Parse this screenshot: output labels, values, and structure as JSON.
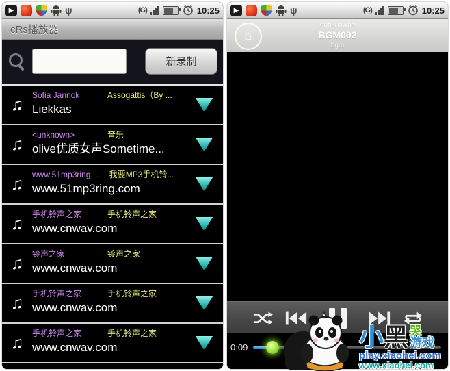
{
  "status_bar": {
    "time": "10:25",
    "data_mode": "(G)"
  },
  "left_screen": {
    "app_title": "cRs播放器",
    "search": {
      "value": "",
      "record_button": "新录制"
    },
    "songs": [
      {
        "artist": "Sofia Jannok",
        "album": "Assogattis（By ...",
        "title": "Liekkas"
      },
      {
        "artist": "<unknown>",
        "album": "音乐",
        "title": "olive优质女声Sometime..."
      },
      {
        "artist": "www.51mp3ring....",
        "album": "我要MP3手机铃...",
        "title": "www.51mp3ring.com"
      },
      {
        "artist": "手机铃声之家",
        "album": "手机铃声之家",
        "title": "www.cnwav.com"
      },
      {
        "artist": "铃声之家",
        "album": "铃声之家",
        "title": "www.cnwav.com"
      },
      {
        "artist": "手机铃声之家",
        "album": "手机铃声之家",
        "title": "www.cnwav.com"
      },
      {
        "artist": "手机铃声之家",
        "album": "手机铃声之家",
        "title": "www.cnwav.com"
      }
    ]
  },
  "right_screen": {
    "now_playing": {
      "artist": "<unknown>",
      "title": "BGM002",
      "album": "bgm"
    },
    "progress": {
      "elapsed": "0:09",
      "percent": 10
    }
  },
  "watermark": {
    "char1": "小",
    "char2": "黑",
    "cry": "哭",
    "games": "游戏",
    "line1": "play.xiaohei.com",
    "line2": "www.xiaohei.com"
  },
  "colors": {
    "accent_teal": "#25b4ae",
    "artist_purple": "#cc88ee",
    "album_yellow": "#e8e87c",
    "progress_blue": "#2f7fd4",
    "thumb_green": "#9be338"
  }
}
